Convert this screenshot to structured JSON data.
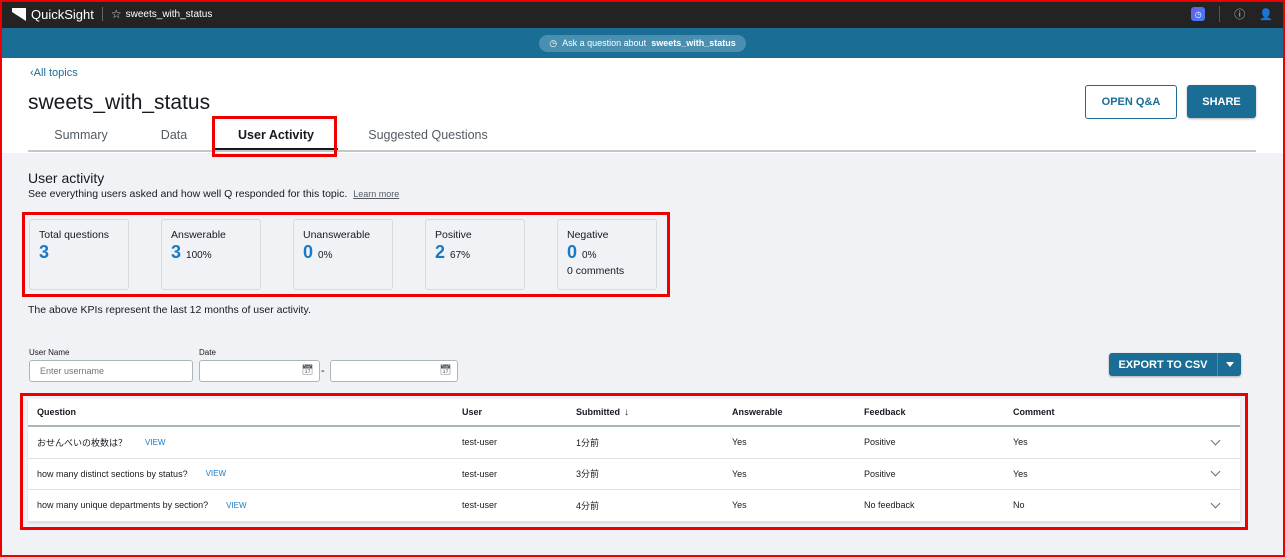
{
  "app": {
    "name": "QuickSight",
    "document_name": "sweets_with_status"
  },
  "topbar": {
    "icons": [
      "q-assistant-icon",
      "help-icon",
      "user-icon"
    ]
  },
  "ask_bar": {
    "prefix": "Ask a question about",
    "topic": "sweets_with_status"
  },
  "header": {
    "back_link": "All topics",
    "title": "sweets_with_status",
    "open_qa_label": "OPEN Q&A",
    "share_label": "SHARE",
    "tabs": [
      {
        "label": "Summary",
        "active": false
      },
      {
        "label": "Data",
        "active": false
      },
      {
        "label": "User Activity",
        "active": true
      },
      {
        "label": "Suggested Questions",
        "active": false
      }
    ]
  },
  "section": {
    "title": "User activity",
    "subtitle": "See everything users asked and how well Q responded for this topic.",
    "learn_more": "Learn more"
  },
  "kpis": [
    {
      "label": "Total questions",
      "value": "3",
      "pct": "",
      "extra": ""
    },
    {
      "label": "Answerable",
      "value": "3",
      "pct": "100%",
      "extra": ""
    },
    {
      "label": "Unanswerable",
      "value": "0",
      "pct": "0%",
      "extra": ""
    },
    {
      "label": "Positive",
      "value": "2",
      "pct": "67%",
      "extra": ""
    },
    {
      "label": "Negative",
      "value": "0",
      "pct": "0%",
      "extra": "0 comments"
    }
  ],
  "kpi_note": "The above KPIs represent the last 12 months of user activity.",
  "filters": {
    "user_name_label": "User Name",
    "user_name_placeholder": "Enter username",
    "user_name_value": "",
    "date_label": "Date",
    "date_from": "",
    "date_to": "",
    "date_separator": "-"
  },
  "export_label": "EXPORT TO CSV",
  "table": {
    "columns": [
      "Question",
      "User",
      "Submitted",
      "Answerable",
      "Feedback",
      "Comment"
    ],
    "sort_column": "Submitted",
    "view_label": "VIEW",
    "rows": [
      {
        "question": "おせんべいの枚数は？",
        "user": "test-user",
        "submitted": "1分前",
        "answerable": "Yes",
        "feedback": "Positive",
        "comment": "Yes"
      },
      {
        "question": "how many distinct sections by status?",
        "user": "test-user",
        "submitted": "3分前",
        "answerable": "Yes",
        "feedback": "Positive",
        "comment": "Yes"
      },
      {
        "question": "how many unique departments by section?",
        "user": "test-user",
        "submitted": "4分前",
        "answerable": "Yes",
        "feedback": "No feedback",
        "comment": "No"
      }
    ]
  },
  "colors": {
    "accent": "#1a6d94",
    "kpi_value": "#1a7ac4",
    "highlight": "#ee0000",
    "topbar": "#232323"
  }
}
